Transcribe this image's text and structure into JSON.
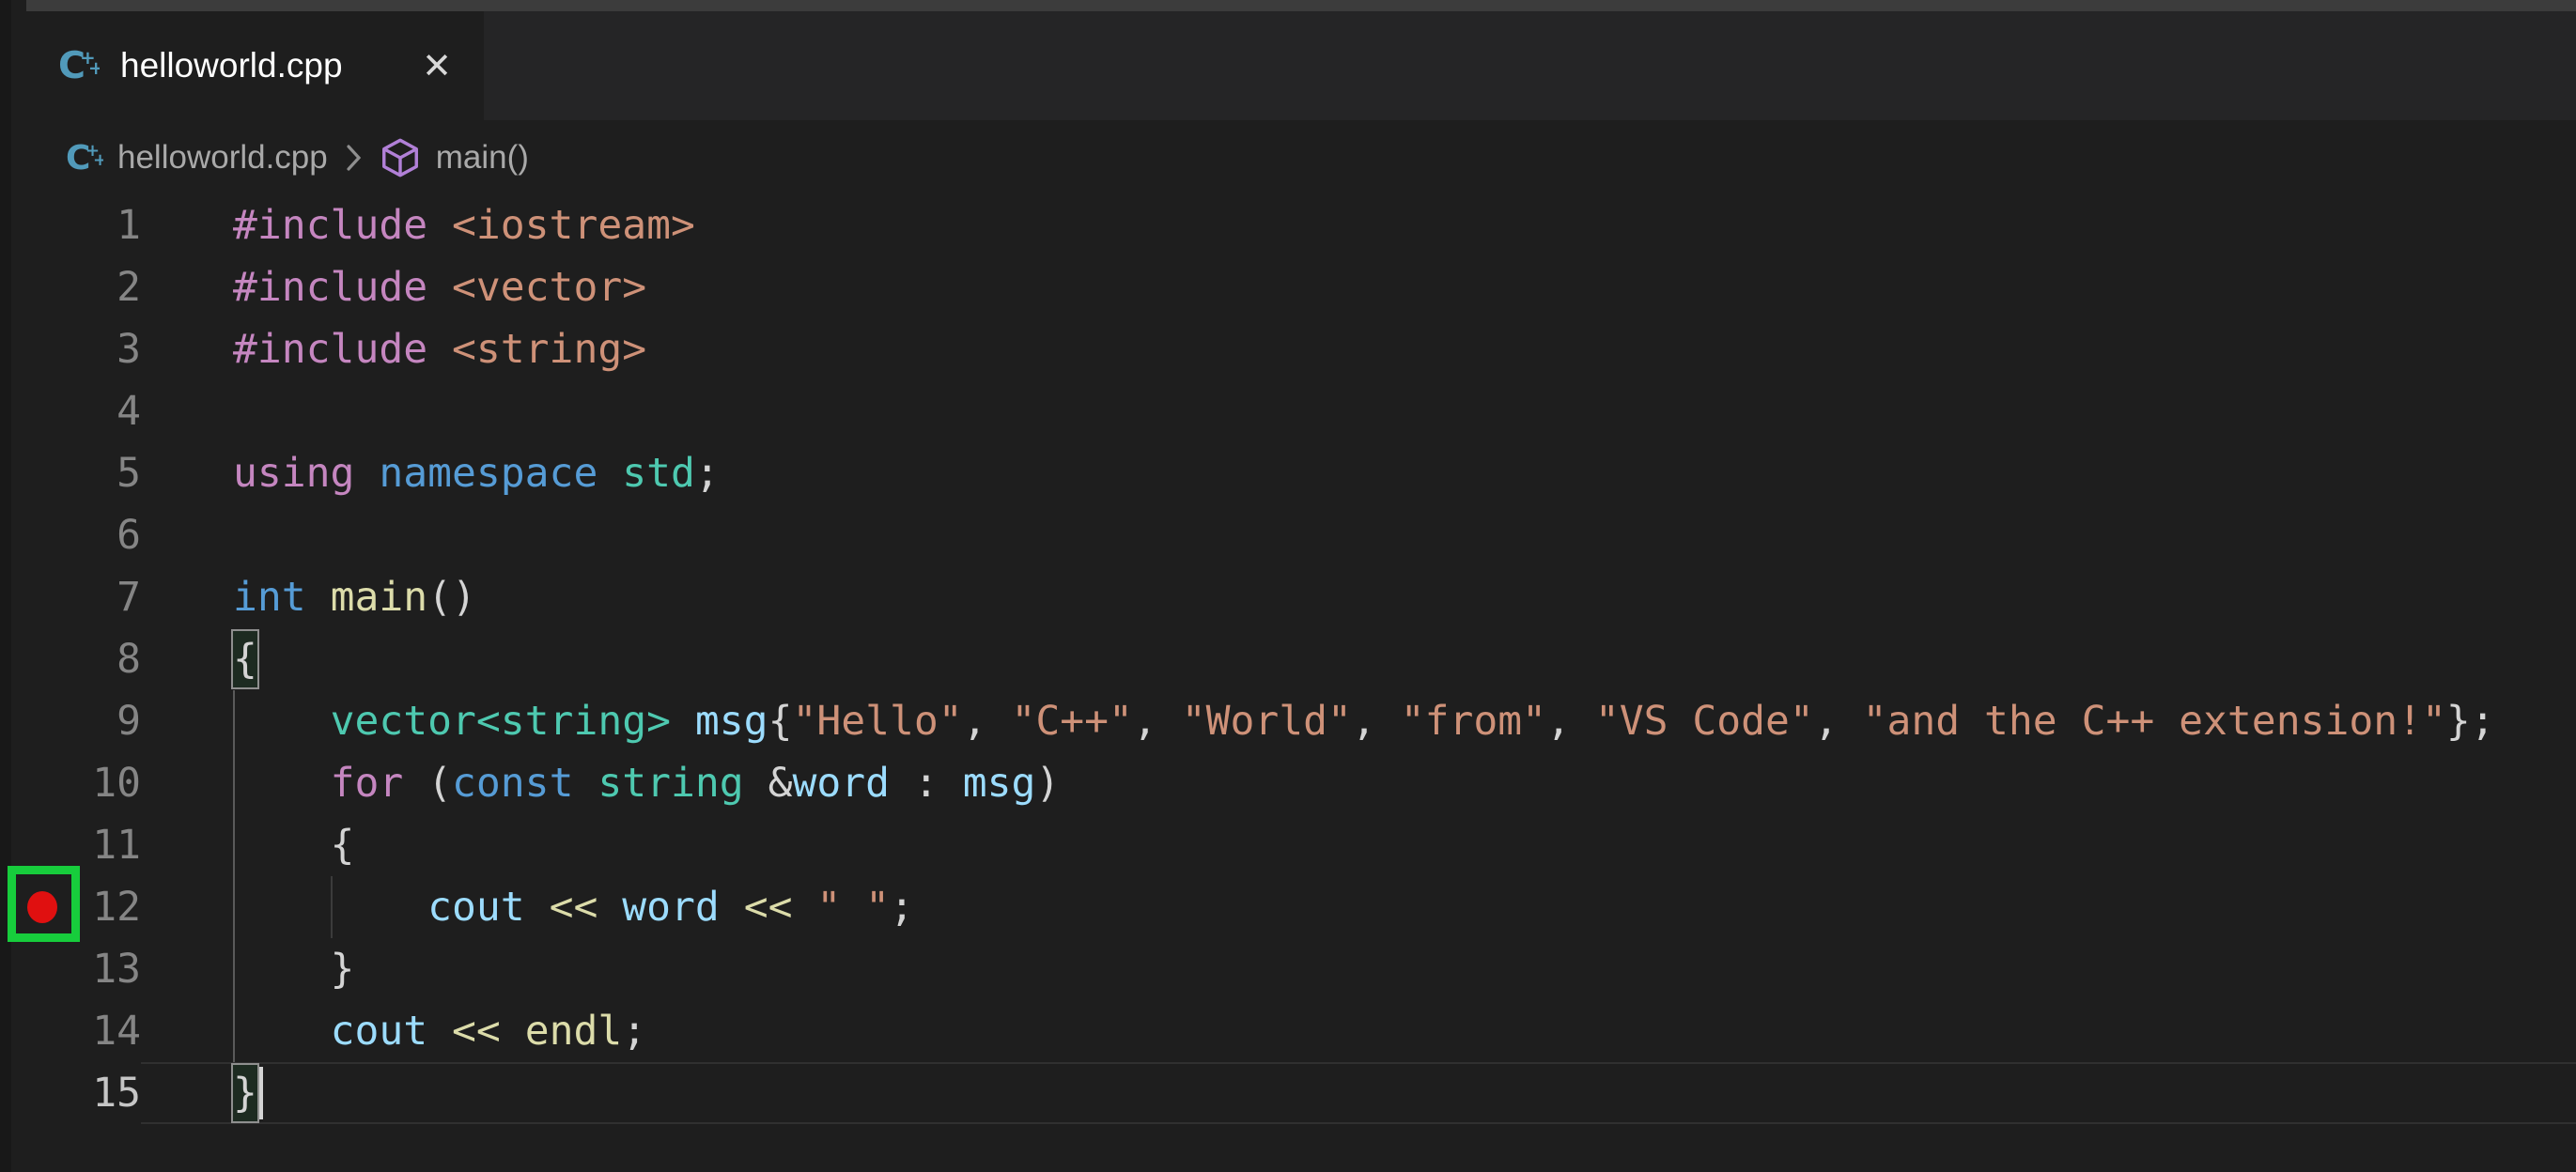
{
  "tab": {
    "label": "helloworld.cpp",
    "close_glyph": "✕"
  },
  "breadcrumb": {
    "file": "helloworld.cpp",
    "symbol": "main()"
  },
  "icons": {
    "tab_file": "cpp-file-icon",
    "breadcrumb_file": "cpp-file-icon",
    "breadcrumb_symbol": "symbol-method-icon",
    "separator": "chevron-right-icon",
    "close": "close-icon",
    "breakpoint": "breakpoint-icon"
  },
  "colors": {
    "editor_bg": "#1e1e1e",
    "tabbar_bg": "#252526",
    "titlebar_bg": "#3c3c3c",
    "left_edge": "#181818",
    "tab_fg": "#ffffff",
    "breadcrumb_fg": "#a9a9a9",
    "lnum": "#858585",
    "lnum_active": "#c6c6c6",
    "tok_pp": "#C586C0",
    "tok_kw": "#569CD6",
    "tok_type": "#4EC9B0",
    "tok_fn": "#DCDCAA",
    "tok_var": "#9CDCFE",
    "tok_str": "#CE9178",
    "tok_plain": "#D4D4D4",
    "cpp_icon": "#519ABA",
    "symbol_icon": "#B180D7",
    "bp_red": "#E01010",
    "annotation_green": "#17CD3C",
    "bracket_border": "#8f8f8f",
    "bracket_bg": "#1d2b21",
    "guide_active": "#5a5a5a",
    "guide_dim": "#3b3b3b",
    "line_highlight": "#303030",
    "cursor": "#d4d4d4"
  },
  "editor": {
    "breakpoint_line": 12,
    "active_line": 15,
    "cursor_line": 15,
    "lines": [
      {
        "num": 1,
        "tokens": [
          {
            "c": "pp",
            "t": "#include"
          },
          {
            "c": "pl",
            "t": " "
          },
          {
            "c": "str",
            "t": "<iostream>"
          }
        ]
      },
      {
        "num": 2,
        "tokens": [
          {
            "c": "pp",
            "t": "#include"
          },
          {
            "c": "pl",
            "t": " "
          },
          {
            "c": "str",
            "t": "<vector>"
          }
        ]
      },
      {
        "num": 3,
        "tokens": [
          {
            "c": "pp",
            "t": "#include"
          },
          {
            "c": "pl",
            "t": " "
          },
          {
            "c": "str",
            "t": "<string>"
          }
        ]
      },
      {
        "num": 4,
        "tokens": []
      },
      {
        "num": 5,
        "tokens": [
          {
            "c": "pp",
            "t": "using"
          },
          {
            "c": "pl",
            "t": " "
          },
          {
            "c": "kw",
            "t": "namespace"
          },
          {
            "c": "pl",
            "t": " "
          },
          {
            "c": "type",
            "t": "std"
          },
          {
            "c": "pl",
            "t": ";"
          }
        ]
      },
      {
        "num": 6,
        "tokens": []
      },
      {
        "num": 7,
        "tokens": [
          {
            "c": "kw",
            "t": "int"
          },
          {
            "c": "pl",
            "t": " "
          },
          {
            "c": "fn",
            "t": "main"
          },
          {
            "c": "pl",
            "t": "()"
          }
        ]
      },
      {
        "num": 8,
        "tokens": [
          {
            "c": "pl",
            "t": "{",
            "box": true
          }
        ]
      },
      {
        "num": 9,
        "guides": [
          {
            "col": 0,
            "active": true
          }
        ],
        "tokens": [
          {
            "c": "pl",
            "t": "    "
          },
          {
            "c": "type",
            "t": "vector<string>"
          },
          {
            "c": "pl",
            "t": " "
          },
          {
            "c": "var",
            "t": "msg"
          },
          {
            "c": "pl",
            "t": "{"
          },
          {
            "c": "str",
            "t": "\"Hello\""
          },
          {
            "c": "pl",
            "t": ", "
          },
          {
            "c": "str",
            "t": "\"C++\""
          },
          {
            "c": "pl",
            "t": ", "
          },
          {
            "c": "str",
            "t": "\"World\""
          },
          {
            "c": "pl",
            "t": ", "
          },
          {
            "c": "str",
            "t": "\"from\""
          },
          {
            "c": "pl",
            "t": ", "
          },
          {
            "c": "str",
            "t": "\"VS Code\""
          },
          {
            "c": "pl",
            "t": ", "
          },
          {
            "c": "str",
            "t": "\"and the C++ extension!\""
          },
          {
            "c": "pl",
            "t": "};"
          }
        ]
      },
      {
        "num": 10,
        "guides": [
          {
            "col": 0,
            "active": true
          }
        ],
        "tokens": [
          {
            "c": "pl",
            "t": "    "
          },
          {
            "c": "pp",
            "t": "for"
          },
          {
            "c": "pl",
            "t": " ("
          },
          {
            "c": "kw",
            "t": "const"
          },
          {
            "c": "pl",
            "t": " "
          },
          {
            "c": "type",
            "t": "string"
          },
          {
            "c": "pl",
            "t": " &"
          },
          {
            "c": "var",
            "t": "word"
          },
          {
            "c": "pl",
            "t": " : "
          },
          {
            "c": "var",
            "t": "msg"
          },
          {
            "c": "pl",
            "t": ")"
          }
        ]
      },
      {
        "num": 11,
        "guides": [
          {
            "col": 0,
            "active": true
          }
        ],
        "tokens": [
          {
            "c": "pl",
            "t": "    {"
          }
        ]
      },
      {
        "num": 12,
        "guides": [
          {
            "col": 0,
            "active": true
          },
          {
            "col": 4,
            "active": false
          }
        ],
        "tokens": [
          {
            "c": "pl",
            "t": "        "
          },
          {
            "c": "var",
            "t": "cout"
          },
          {
            "c": "pl",
            "t": " "
          },
          {
            "c": "fn",
            "t": "<<"
          },
          {
            "c": "pl",
            "t": " "
          },
          {
            "c": "var",
            "t": "word"
          },
          {
            "c": "pl",
            "t": " "
          },
          {
            "c": "fn",
            "t": "<<"
          },
          {
            "c": "pl",
            "t": " "
          },
          {
            "c": "str",
            "t": "\" \""
          },
          {
            "c": "pl",
            "t": ";"
          }
        ]
      },
      {
        "num": 13,
        "guides": [
          {
            "col": 0,
            "active": true
          }
        ],
        "tokens": [
          {
            "c": "pl",
            "t": "    }"
          }
        ]
      },
      {
        "num": 14,
        "guides": [
          {
            "col": 0,
            "active": true
          }
        ],
        "tokens": [
          {
            "c": "pl",
            "t": "    "
          },
          {
            "c": "var",
            "t": "cout"
          },
          {
            "c": "pl",
            "t": " "
          },
          {
            "c": "fn",
            "t": "<<"
          },
          {
            "c": "pl",
            "t": " "
          },
          {
            "c": "fn",
            "t": "endl"
          },
          {
            "c": "pl",
            "t": ";"
          }
        ]
      },
      {
        "num": 15,
        "tokens": [
          {
            "c": "pl",
            "t": "}",
            "box": true
          }
        ]
      }
    ]
  }
}
